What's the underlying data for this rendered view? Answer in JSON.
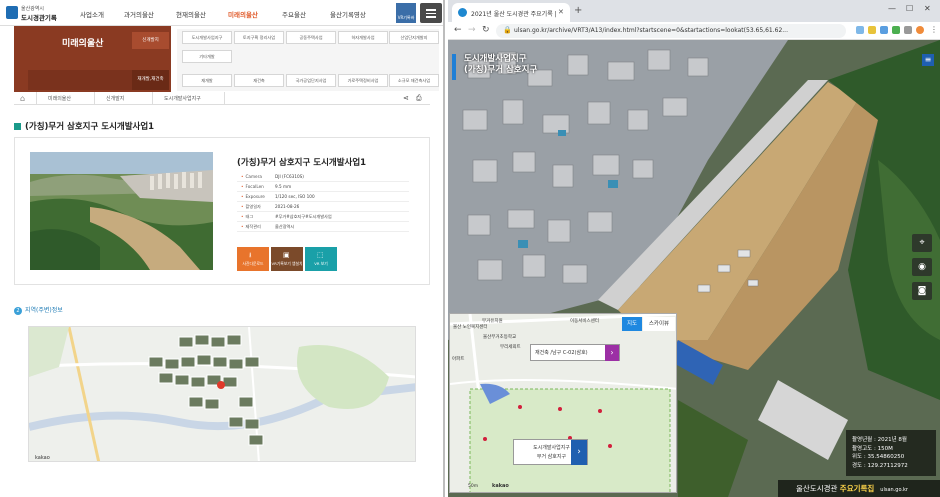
{
  "left": {
    "logo": {
      "line1": "울산광역시",
      "line2": "도시경관기록"
    },
    "nav": [
      "사업소개",
      "과거의울산",
      "현재의울산",
      "미래의울산",
      "주요울산",
      "울산기록영상"
    ],
    "nav_active_index": 3,
    "vr_label": "VR기록바로",
    "banner": {
      "title": "미래의울산",
      "sub1": "신개발지",
      "sub2": "재개발,재건축"
    },
    "submenu": [
      "도시개발사업지구",
      "토지구획 정리사업",
      "공동주택사업",
      "하자개발사업",
      "산업단지개발지",
      "기타개발",
      "재개발",
      "재건축",
      "국가공업단지사업",
      "가로주택정비사업",
      "소규모 재건축사업"
    ],
    "breadcrumb": [
      "미래의울산",
      "신개발지",
      "도시개발사업지구"
    ],
    "page_title": "(가칭)무거 삼호지구 도시개발사업1",
    "detail": {
      "title": "(가칭)무거 삼호지구 도시개발사업1",
      "rows": [
        {
          "k": "Camera",
          "v": "DJI (FC6310S)"
        },
        {
          "k": "FocalLen",
          "v": "9.5 mm"
        },
        {
          "k": "Exposure",
          "v": "1/120 sec, ISO 100"
        },
        {
          "k": "촬영일자",
          "v": "2021-08-26"
        },
        {
          "k": "태그",
          "v": "#무거#삼호지구#도시개발사업"
        },
        {
          "k": "제작관리",
          "v": "울산광역시"
        }
      ],
      "buttons": [
        "사진다운로드",
        "VR기록보기 앱설치",
        "VR 보기"
      ]
    },
    "section2": {
      "num": "2",
      "label": "지역(주변)정보"
    }
  },
  "right": {
    "tab_title": "2021년 울산 도시경관 주요기록 | ...",
    "url": "ulsan.go.kr/archive/VRT3/A13/index.html?startscene=0&startactions=lookat(53.65,61.62...",
    "vr_title": [
      "도시개발사업지구",
      "(가칭)무거 삼호지구"
    ],
    "minimap": {
      "tab_map": "지도",
      "tab_sky": "스카이뷰",
      "popup": "재건축 /남구 C-02(삼호)",
      "callout": [
        "도시개발사업지구",
        "무거 삼호지구"
      ],
      "labels": [
        "울산 노인복지센터",
        "무거유치원",
        "이동서비스센터",
        "울산무거초등학교",
        "무리세뫼트",
        "아파트"
      ],
      "scale": "50m",
      "brand": "kakao"
    },
    "info": [
      {
        "k": "촬영년월",
        "v": "2021년 8월"
      },
      {
        "k": "촬영고도",
        "v": "150M"
      },
      {
        "k": "위도",
        "v": "35.54860250"
      },
      {
        "k": "경도",
        "v": "129.27112972"
      }
    ],
    "footer": {
      "brand1": "울산도시경관",
      "brand2": "주요기록집",
      "site": "ulsan.go.kr"
    }
  },
  "colors": {
    "accent": "#e05a2a",
    "banner": "#8a3a22",
    "teal": "#1a9a8a",
    "blue": "#1f5fb0",
    "purple": "#9c2fa5",
    "orange_btn": "#e8742c",
    "brown_btn": "#7b4a2a",
    "teal_btn": "#1aa0a8"
  },
  "icons": [
    "home-icon",
    "share-icon",
    "print-icon",
    "menu-icon",
    "download-icon",
    "location-icon",
    "compass-icon",
    "camera-icon",
    "list-icon",
    "lock-icon",
    "back-icon",
    "forward-icon",
    "reload-icon"
  ]
}
